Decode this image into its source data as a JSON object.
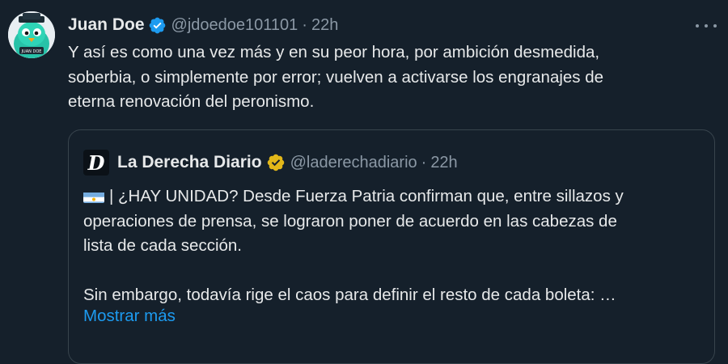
{
  "tweet": {
    "author_name": "Juan Doe",
    "author_handle": "@jdoedoe101101",
    "separator": "·",
    "time": "22h",
    "text": "Y así es como una vez más y en su peor hora, por ambición desmedida,\nsoberbia, o simplemente por error; vuelven a activarse los engranajes de\neterna renovación del peronismo.",
    "avatar_label": "JUAN DOE"
  },
  "quote": {
    "author_name": "La Derecha Diario",
    "author_handle": "@laderechadiario",
    "separator": "·",
    "time": "22h",
    "logo_letter": "D",
    "text": "| ¿HAY UNIDAD? Desde Fuerza Patria confirman que, entre sillazos y\noperaciones de prensa, se lograron poner de acuerdo en las cabezas de\nlista de cada sección.\n\nSin embargo, todavía rige el caos para definir el resto de cada boleta: …",
    "show_more": "Mostrar más"
  },
  "icons": {
    "verified": "verified-badge-icon",
    "gold_verified": "gold-verified-badge-icon",
    "more": "more-options-icon",
    "flag": "argentina-flag-icon"
  },
  "colors": {
    "background": "#15202b",
    "text": "#e7e9ea",
    "muted": "#8b98a5",
    "link": "#1d9bf0",
    "verified_blue": "#1d9bf0",
    "verified_gold": "#e2b719",
    "border": "#38444d"
  }
}
